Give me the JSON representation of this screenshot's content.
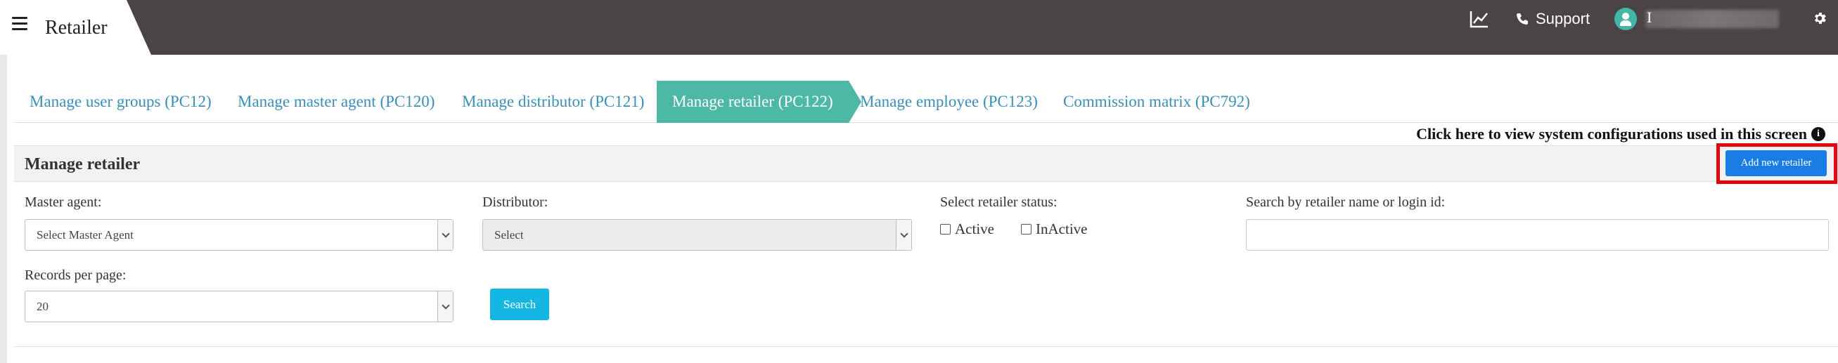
{
  "header": {
    "app_title": "Retailer",
    "support_label": "Support",
    "user_initial": "I"
  },
  "tabs": [
    {
      "label": "Manage user groups (PC12)",
      "active": false
    },
    {
      "label": "Manage master agent (PC120)",
      "active": false
    },
    {
      "label": "Manage distributor (PC121)",
      "active": false
    },
    {
      "label": "Manage retailer (PC122)",
      "active": true
    },
    {
      "label": "Manage employee (PC123)",
      "active": false
    },
    {
      "label": "Commission matrix (PC792)",
      "active": false
    }
  ],
  "sys_config_link": "Click here to view system configurations used in this screen",
  "panel": {
    "title": "Manage retailer",
    "add_button": "Add new retailer"
  },
  "filters": {
    "master_agent_label": "Master agent:",
    "master_agent_value": "Select Master Agent",
    "distributor_label": "Distributor:",
    "distributor_value": "Select",
    "status_label": "Select retailer status:",
    "status_active": "Active",
    "status_inactive": "InActive",
    "search_label": "Search by retailer name or login id:",
    "search_value": "",
    "records_label": "Records per page:",
    "records_value": "20",
    "search_button": "Search"
  },
  "colors": {
    "topbar": "#4a4447",
    "active_tab": "#4db8a6",
    "tab_text": "#3a8fb7",
    "add_button": "#1a7de6",
    "highlight_border": "#e1060f",
    "search_button": "#14b7e4"
  }
}
